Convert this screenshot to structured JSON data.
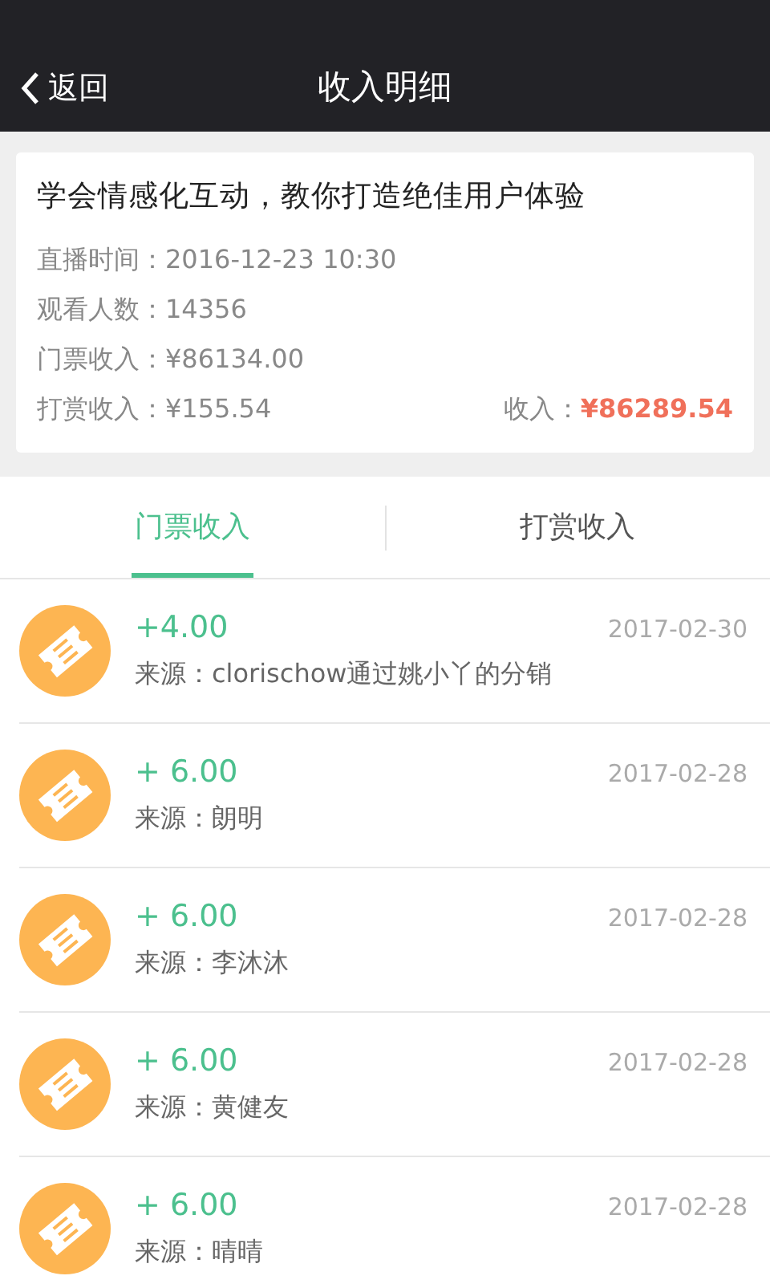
{
  "header": {
    "back": "返回",
    "title": "收入明细"
  },
  "summary": {
    "title": "学会情感化互动，教你打造绝佳用户体验",
    "lines": [
      {
        "label": "直播时间：",
        "value": "2016-12-23 10:30"
      },
      {
        "label": "观看人数：",
        "value": "14356"
      },
      {
        "label": "门票收入：",
        "value": "¥86134.00"
      },
      {
        "label": "打赏收入：",
        "value": "¥155.54"
      }
    ],
    "total_label": "收入：",
    "total_value": "¥86289.54"
  },
  "tabs": [
    {
      "label": "门票收入",
      "selected": true
    },
    {
      "label": "打赏收入",
      "selected": false
    }
  ],
  "records": [
    {
      "amount": "+4.00",
      "date": "2017-02-30",
      "source": "来源：clorischow通过姚小丫的分销"
    },
    {
      "amount": "+ 6.00",
      "date": "2017-02-28",
      "source": "来源：朗明"
    },
    {
      "amount": "+ 6.00",
      "date": "2017-02-28",
      "source": "来源：李沐沐"
    },
    {
      "amount": "+ 6.00",
      "date": "2017-02-28",
      "source": "来源：黄健友"
    },
    {
      "amount": "+ 6.00",
      "date": "2017-02-28",
      "source": "来源：晴晴"
    }
  ]
}
